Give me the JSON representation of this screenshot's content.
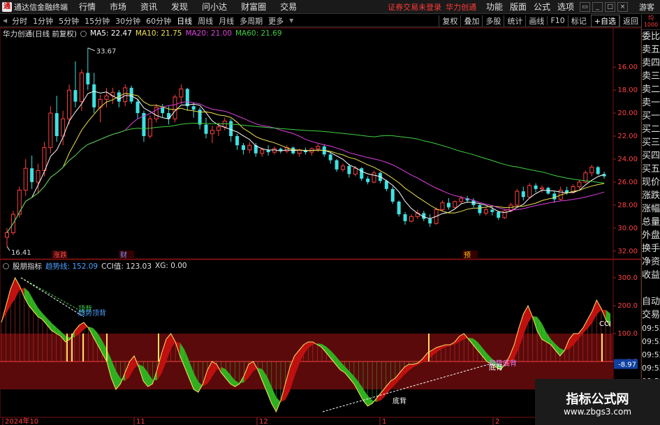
{
  "app": {
    "title": "通达信金融终端",
    "logo_char": "通",
    "menu": [
      "行情",
      "市场",
      "资讯",
      "发现",
      "问小达",
      "财富圈",
      "交易"
    ],
    "broker_message": "证券交易未登录",
    "stock_name": "华力创通",
    "right_menu": [
      "功能",
      "版面",
      "公式",
      "选项"
    ],
    "guest_label": "游客"
  },
  "toolbar": {
    "periods": [
      "分时",
      "1分钟",
      "5分钟",
      "15分钟",
      "30分钟",
      "60分钟",
      "日线",
      "周线",
      "月线",
      "多周期",
      "更多"
    ],
    "active_period": "日线",
    "right_buttons": [
      "复权",
      "叠加",
      "多股",
      "统计",
      "画线",
      "F10",
      "标记"
    ],
    "add_favorite": "+自选",
    "back": "返回"
  },
  "main_chart_info": {
    "stock_title": "华力创通(日线 前复权)",
    "ma5": "MA5: 22.47",
    "ma10": "MA10: 21.75",
    "ma20": "MA20: 21.00",
    "ma60": "MA60: 21.69",
    "colors": {
      "ma5": "#ffffff",
      "ma10": "#f0e050",
      "ma20": "#e040e0",
      "ma60": "#40d040"
    }
  },
  "indicator_info": {
    "name": "股朋指标",
    "trend": "趋势线: 152.09",
    "cci": "CCI值: 123.03",
    "xg": "XG: 0.00"
  },
  "annotations": {
    "high_label": "33.67",
    "low_label": "16.41",
    "markers": [
      "涨跌",
      "财",
      "预"
    ],
    "ind_labels": [
      "顶背",
      "趋势顶背",
      "趋势底背",
      "底背",
      "底背",
      "CCI",
      "-8.97"
    ]
  },
  "axis": {
    "price_ticks": [
      "32.00",
      "30.00",
      "28.00",
      "26.00",
      "24.00",
      "22.00",
      "20.00",
      "18.00",
      "16.00"
    ],
    "ind_ticks": [
      "300.0",
      "200.0",
      "100.0",
      "0.0",
      "-100.0"
    ],
    "date_labels": [
      "2024年10",
      "11",
      "12",
      "1",
      "2"
    ]
  },
  "sidepanel": {
    "top": "均 1000",
    "items": [
      "委比",
      "卖五",
      "卖四",
      "卖三",
      "卖二",
      "卖一",
      "买一",
      "买二",
      "买三",
      "买四",
      "买五",
      "现价",
      "涨跌",
      "涨幅",
      "总量",
      "外盘",
      "换手",
      "净资",
      "收益",
      "",
      "自动",
      "交易",
      "09:52",
      "09:52",
      "09:52",
      "09:52",
      "09:52",
      "09:52",
      "09:52",
      "09:52",
      "09:52"
    ]
  },
  "watermark": {
    "title": "指标公式网",
    "url": "www.zbgs3.com"
  },
  "chart_data": [
    {
      "type": "candlestick",
      "title": "华力创通(日线 前复权)",
      "ylim": [
        15.5,
        34.5
      ],
      "y_ticks": [
        16,
        18,
        20,
        22,
        24,
        26,
        28,
        30,
        32
      ],
      "x_labels": [
        "2024年10",
        "11",
        "12",
        "1",
        "2"
      ],
      "candles": [
        [
          17.2,
          18.0,
          16.4,
          17.6
        ],
        [
          17.6,
          19.5,
          17.4,
          19.2
        ],
        [
          19.2,
          21.6,
          18.9,
          21.3
        ],
        [
          21.3,
          24.0,
          20.8,
          23.2
        ],
        [
          23.2,
          24.3,
          21.4,
          22.0
        ],
        [
          22.0,
          23.6,
          21.0,
          23.0
        ],
        [
          23.0,
          25.5,
          22.5,
          25.0
        ],
        [
          25.0,
          28.6,
          24.5,
          28.0
        ],
        [
          28.0,
          29.5,
          25.5,
          26.0
        ],
        [
          26.0,
          28.2,
          25.2,
          27.5
        ],
        [
          27.5,
          30.5,
          27.0,
          30.0
        ],
        [
          30.0,
          32.5,
          28.5,
          29.0
        ],
        [
          29.0,
          31.8,
          28.2,
          31.5
        ],
        [
          31.5,
          33.67,
          30.0,
          30.5
        ],
        [
          30.5,
          31.5,
          28.0,
          28.5
        ],
        [
          28.5,
          29.6,
          27.2,
          29.2
        ],
        [
          29.2,
          30.2,
          28.5,
          29.5
        ],
        [
          29.5,
          30.2,
          28.8,
          29.8
        ],
        [
          29.8,
          30.0,
          28.5,
          29.0
        ],
        [
          29.0,
          30.5,
          28.6,
          30.2
        ],
        [
          30.2,
          30.4,
          28.8,
          29.0
        ],
        [
          29.0,
          29.2,
          27.5,
          28.0
        ],
        [
          28.0,
          28.2,
          25.5,
          26.0
        ],
        [
          26.0,
          27.8,
          25.8,
          27.5
        ],
        [
          27.5,
          28.8,
          27.2,
          28.5
        ],
        [
          28.5,
          28.8,
          27.6,
          28.0
        ],
        [
          28.0,
          28.6,
          27.0,
          27.5
        ],
        [
          27.5,
          29.6,
          27.2,
          29.4
        ],
        [
          29.4,
          30.5,
          28.8,
          30.1
        ],
        [
          30.1,
          30.2,
          28.2,
          28.6
        ],
        [
          28.6,
          28.9,
          27.6,
          28.3
        ],
        [
          28.3,
          28.5,
          26.6,
          27.0
        ],
        [
          27.0,
          27.6,
          25.8,
          26.2
        ],
        [
          26.2,
          26.9,
          25.4,
          26.5
        ],
        [
          26.5,
          27.2,
          26.0,
          26.8
        ],
        [
          26.8,
          27.6,
          26.5,
          27.3
        ],
        [
          27.3,
          27.5,
          25.5,
          26.0
        ],
        [
          26.0,
          26.2,
          24.8,
          25.2
        ],
        [
          25.2,
          25.4,
          24.4,
          24.8
        ],
        [
          24.8,
          25.5,
          24.5,
          25.2
        ],
        [
          25.2,
          25.4,
          24.2,
          24.5
        ],
        [
          24.5,
          25.0,
          24.2,
          24.8
        ],
        [
          24.8,
          25.2,
          24.3,
          24.6
        ],
        [
          24.6,
          25.1,
          24.4,
          24.9
        ],
        [
          24.9,
          25.0,
          24.5,
          24.7
        ],
        [
          24.7,
          25.2,
          24.5,
          25.0
        ],
        [
          25.0,
          25.1,
          24.4,
          24.5
        ],
        [
          24.5,
          24.9,
          24.2,
          24.8
        ],
        [
          24.8,
          25.0,
          24.4,
          24.6
        ],
        [
          24.6,
          25.0,
          24.3,
          24.9
        ],
        [
          24.9,
          25.3,
          24.6,
          25.1
        ],
        [
          25.1,
          25.3,
          24.2,
          24.4
        ],
        [
          24.4,
          24.6,
          23.6,
          23.9
        ],
        [
          23.9,
          24.0,
          22.9,
          23.1
        ],
        [
          23.1,
          23.6,
          22.9,
          23.4
        ],
        [
          23.4,
          23.6,
          22.4,
          22.7
        ],
        [
          22.7,
          23.4,
          22.5,
          23.2
        ],
        [
          23.2,
          23.3,
          22.1,
          22.3
        ],
        [
          22.3,
          22.5,
          21.8,
          22.0
        ],
        [
          22.0,
          23.0,
          21.9,
          22.8
        ],
        [
          22.8,
          22.9,
          21.9,
          22.1
        ],
        [
          22.1,
          22.2,
          21.2,
          21.4
        ],
        [
          21.4,
          21.6,
          20.1,
          20.3
        ],
        [
          20.3,
          20.4,
          19.0,
          19.2
        ],
        [
          19.2,
          19.4,
          18.3,
          18.6
        ],
        [
          18.6,
          19.2,
          18.5,
          19.0
        ],
        [
          19.0,
          19.6,
          18.8,
          19.3
        ],
        [
          19.3,
          19.5,
          18.6,
          18.8
        ],
        [
          18.8,
          19.2,
          18.1,
          18.4
        ],
        [
          18.4,
          19.8,
          18.3,
          19.6
        ],
        [
          19.6,
          20.4,
          19.5,
          20.2
        ],
        [
          20.2,
          20.6,
          19.6,
          19.8
        ],
        [
          19.8,
          20.4,
          19.7,
          20.3
        ],
        [
          20.3,
          20.8,
          20.1,
          20.6
        ],
        [
          20.6,
          20.8,
          20.2,
          20.4
        ],
        [
          20.4,
          20.6,
          19.8,
          20.0
        ],
        [
          20.0,
          20.1,
          19.1,
          19.3
        ],
        [
          19.3,
          19.8,
          19.1,
          19.6
        ],
        [
          19.6,
          19.9,
          19.1,
          19.4
        ],
        [
          19.4,
          19.5,
          18.7,
          18.9
        ],
        [
          18.9,
          19.6,
          18.8,
          19.5
        ],
        [
          19.5,
          20.2,
          19.4,
          20.0
        ],
        [
          20.0,
          21.4,
          19.9,
          21.2
        ],
        [
          21.2,
          21.6,
          20.4,
          20.7
        ],
        [
          20.7,
          21.9,
          20.6,
          21.7
        ],
        [
          21.7,
          21.9,
          21.1,
          21.4
        ],
        [
          21.4,
          21.7,
          21.1,
          21.5
        ],
        [
          21.5,
          21.6,
          20.9,
          21.0
        ],
        [
          21.0,
          21.2,
          20.2,
          20.5
        ],
        [
          20.5,
          21.6,
          20.4,
          21.3
        ],
        [
          21.3,
          21.6,
          20.9,
          21.1
        ],
        [
          21.1,
          21.8,
          21.0,
          21.6
        ],
        [
          21.6,
          22.2,
          21.4,
          22.0
        ],
        [
          22.0,
          23.0,
          21.9,
          22.8
        ],
        [
          22.8,
          23.5,
          22.5,
          23.3
        ],
        [
          23.3,
          23.4,
          22.6,
          22.7
        ],
        [
          22.7,
          22.9,
          22.3,
          22.5
        ]
      ],
      "series": [
        {
          "name": "MA5",
          "color": "#ffffff"
        },
        {
          "name": "MA10",
          "color": "#f0e050"
        },
        {
          "name": "MA20",
          "color": "#e040e0"
        },
        {
          "name": "MA60",
          "color": "#40d040"
        }
      ]
    },
    {
      "type": "area",
      "title": "股朋指标",
      "ylim": [
        -200,
        330
      ],
      "y_ticks": [
        300,
        200,
        100,
        0,
        -100
      ],
      "cci": [
        140,
        200,
        260,
        300,
        270,
        230,
        200,
        180,
        160,
        150,
        130,
        110,
        100,
        90,
        70,
        80,
        110,
        130,
        140,
        120,
        90,
        60,
        30,
        0,
        -60,
        -100,
        -80,
        -40,
        0,
        20,
        -20,
        -70,
        -90,
        -80,
        -30,
        30,
        80,
        100,
        70,
        20,
        -20,
        -60,
        -100,
        -110,
        -80,
        -30,
        0,
        -10,
        -40,
        -60,
        -80,
        -90,
        -80,
        -50,
        -10,
        0,
        -30,
        -70,
        -110,
        -150,
        -180,
        -140,
        -80,
        -20,
        20,
        40,
        60,
        70,
        70,
        60,
        50,
        30,
        10,
        -10,
        -30,
        -40,
        -60,
        -80,
        -110,
        -140,
        -160,
        -150,
        -130,
        -110,
        -90,
        -70,
        -60,
        -40,
        -20,
        -10,
        -10,
        -5,
        10,
        30,
        40,
        50,
        55,
        60,
        60,
        70,
        90,
        100,
        80,
        60,
        40,
        20,
        0,
        -10,
        -20,
        -30,
        -10,
        20,
        60,
        120,
        170,
        200,
        160,
        110,
        80,
        70,
        60,
        40,
        20,
        40,
        80,
        100,
        100,
        120,
        150,
        180,
        220,
        190,
        150,
        125
      ],
      "signal_bars": [
        96,
        103,
        119,
        153,
        227,
        614,
        862
      ]
    }
  ]
}
